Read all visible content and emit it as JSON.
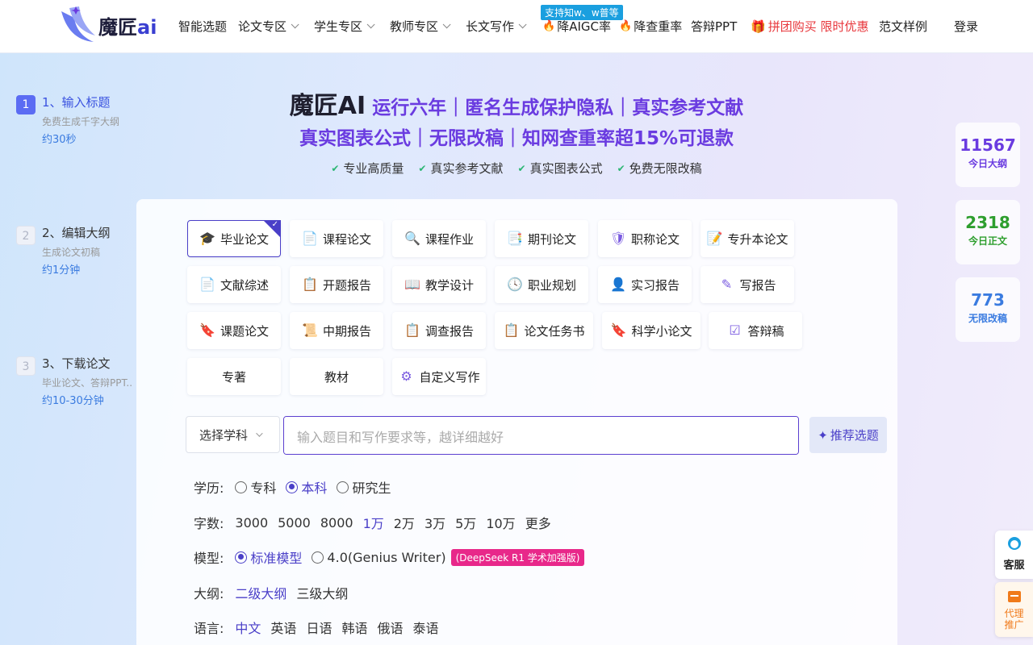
{
  "header": {
    "logo_text": "魔匠",
    "logo_accent": "ai",
    "nav": [
      {
        "label": "智能选题"
      },
      {
        "label": "论文专区"
      },
      {
        "label": "学生专区"
      },
      {
        "label": "教师专区"
      },
      {
        "label": "长文写作"
      },
      {
        "label": "降AIGC率"
      },
      {
        "label": "降查重率"
      },
      {
        "label": "答辩PPT"
      },
      {
        "label": "拼团购买 限时优惠"
      },
      {
        "label": "范文样例"
      },
      {
        "label": "登录"
      }
    ],
    "badge": "支持知w、w普等"
  },
  "steps": [
    {
      "num": "1",
      "title": "1、输入标题",
      "sub": "免费生成千字大纲",
      "time": "约30秒"
    },
    {
      "num": "2",
      "title": "2、编辑大纲",
      "sub": "生成论文初稿",
      "time": "约1分钟"
    },
    {
      "num": "3",
      "title": "3、下载论文",
      "sub": "毕业论文、答辩PPT..",
      "time": "约10-30分钟"
    }
  ],
  "hero": {
    "brand": "魔匠AI",
    "line1": "运行六年｜匿名生成保护隐私｜真实参考文献",
    "line2": "真实图表公式｜无限改稿｜知网查重率超15%可退款",
    "features": [
      "专业高质量",
      "真实参考文献",
      "真实图表公式",
      "免费无限改稿"
    ]
  },
  "stats": [
    {
      "num": "11567",
      "label": "今日大纲",
      "color": "#6a3be0"
    },
    {
      "num": "2318",
      "label": "今日正文",
      "color": "#2e9e2e"
    },
    {
      "num": "773",
      "label": "无限改稿",
      "color": "#3a7be0"
    }
  ],
  "types": [
    {
      "label": "毕业论文",
      "icon": "graduation-cap-icon"
    },
    {
      "label": "课程论文",
      "icon": "document-icon"
    },
    {
      "label": "课程作业",
      "icon": "search-doc-icon"
    },
    {
      "label": "期刊论文",
      "icon": "journal-icon"
    },
    {
      "label": "职称论文",
      "icon": "badge-icon"
    },
    {
      "label": "专升本论文",
      "icon": "edit-doc-icon"
    },
    {
      "label": "文献综述",
      "icon": "document-icon"
    },
    {
      "label": "开题报告",
      "icon": "report-icon"
    },
    {
      "label": "教学设计",
      "icon": "book-icon"
    },
    {
      "label": "职业规划",
      "icon": "clock-icon"
    },
    {
      "label": "实习报告",
      "icon": "user-icon"
    },
    {
      "label": "写报告",
      "icon": "write-icon"
    },
    {
      "label": "课题论文",
      "icon": "bookmark-icon"
    },
    {
      "label": "中期报告",
      "icon": "list-doc-icon"
    },
    {
      "label": "调查报告",
      "icon": "report-icon"
    },
    {
      "label": "论文任务书",
      "icon": "clipboard-icon"
    },
    {
      "label": "科学小论文",
      "icon": "bookmark-icon"
    },
    {
      "label": "答辩稿",
      "icon": "checklist-icon"
    },
    {
      "label": "专著",
      "icon": ""
    },
    {
      "label": "教材",
      "icon": ""
    },
    {
      "label": "自定义写作",
      "icon": "sliders-icon"
    }
  ],
  "input": {
    "subject_label": "选择学科",
    "placeholder": "输入题目和写作要求等，越详细越好",
    "recommend_label": "推荐选题"
  },
  "options": {
    "education": {
      "label": "学历:",
      "choices": [
        "专科",
        "本科",
        "研究生"
      ],
      "selected": "本科"
    },
    "words": {
      "label": "字数:",
      "choices": [
        "3000",
        "5000",
        "8000",
        "1万",
        "2万",
        "3万",
        "5万",
        "10万",
        "更多"
      ],
      "selected": "1万"
    },
    "model": {
      "label": "模型:",
      "choices": [
        "标准模型",
        "4.0(Genius Writer)"
      ],
      "selected": "标准模型",
      "badge": "(DeepSeek R1 学术加强版)"
    },
    "outline": {
      "label": "大纲:",
      "choices": [
        "二级大纲",
        "三级大纲"
      ],
      "selected": "二级大纲"
    },
    "language": {
      "label": "语言:",
      "choices": [
        "中文",
        "英语",
        "日语",
        "韩语",
        "俄语",
        "泰语"
      ],
      "selected": "中文"
    }
  },
  "float": {
    "cs_label": "客服",
    "agent_label": "代理推广"
  }
}
